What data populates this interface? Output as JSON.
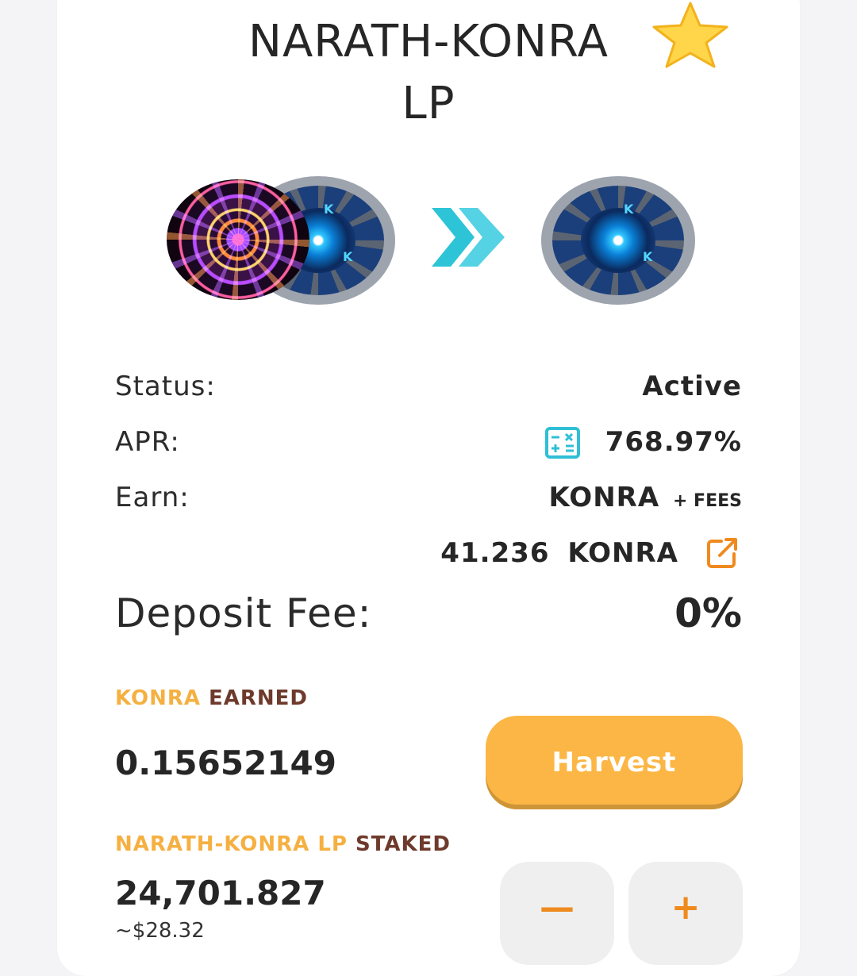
{
  "header": {
    "title_line1": "NARATH-KONRA",
    "title_line2": "LP",
    "favorite_icon": "star-icon"
  },
  "tokens": {
    "left_pair": [
      "narath-token-icon",
      "konra-token-icon"
    ],
    "arrow_icon": "double-chevron-right-icon",
    "right_token": "konra-token-icon",
    "konra_mark": "K"
  },
  "details": {
    "status_label": "Status:",
    "status_value": "Active",
    "apr_label": "APR:",
    "apr_value": "768.97%",
    "apr_icon": "calculator-icon",
    "earn_label": "Earn:",
    "earn_token": "KONRA",
    "earn_fees": "+ FEES",
    "reward_amount": "41.236",
    "reward_token": "KONRA",
    "reward_link_icon": "external-link-icon",
    "deposit_fee_label": "Deposit Fee:",
    "deposit_fee_value": "0%"
  },
  "earned": {
    "token": "KONRA",
    "word": "EARNED",
    "amount": "0.15652149",
    "harvest_label": "Harvest"
  },
  "staked": {
    "token": "NARATH-KONRA LP",
    "word": "STAKED",
    "amount": "24,701.827",
    "usd_value": "~$28.32",
    "minus_label": "—",
    "plus_label": "+"
  },
  "colors": {
    "accent_gold": "#f5b041",
    "brown": "#6e3a2c",
    "harvest_button": "#fcb645",
    "calc_icon": "#2fbfd6",
    "link_icon": "#ef8a1f",
    "arrow_cyan": "#2ec4d8"
  }
}
